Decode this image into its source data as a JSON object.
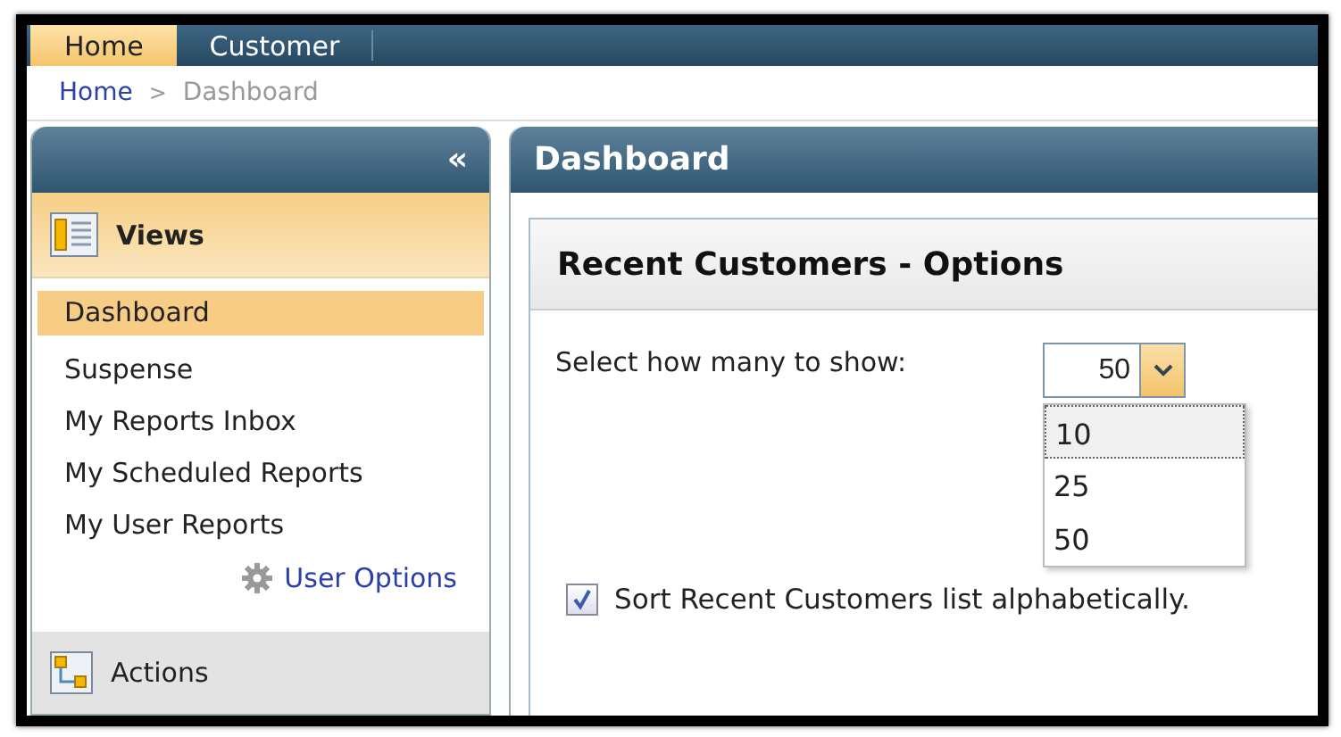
{
  "top_tabs": [
    {
      "label": "Home",
      "selected": true
    },
    {
      "label": "Customer",
      "selected": false
    }
  ],
  "breadcrumb": [
    {
      "label": "Home",
      "kind": "link"
    },
    {
      "label": ">",
      "kind": "separator"
    },
    {
      "label": "Dashboard",
      "kind": "current"
    }
  ],
  "sidebar": {
    "collapse": "«",
    "views": {
      "title": "Views",
      "items": [
        {
          "label": "Dashboard",
          "selected": true
        },
        {
          "label": "Suspense",
          "selected": false
        },
        {
          "label": "My Reports Inbox",
          "selected": false
        },
        {
          "label": "My Scheduled Reports",
          "selected": false
        },
        {
          "label": "My User Reports",
          "selected": false
        }
      ]
    },
    "user_options": "User Options",
    "actions": {
      "title": "Actions"
    }
  },
  "main": {
    "title": "Dashboard",
    "panel": {
      "title": "Recent Customers - Options",
      "count_label": "Select how many to show:",
      "count_select": {
        "value": "50",
        "expanded": true,
        "options": [
          {
            "label": "10",
            "highlighted": true
          },
          {
            "label": "25",
            "highlighted": false
          },
          {
            "label": "50",
            "highlighted": false
          }
        ]
      },
      "sort_checkbox": {
        "label": "Sort Recent Customers list alphabetically.",
        "checked": true
      }
    }
  }
}
